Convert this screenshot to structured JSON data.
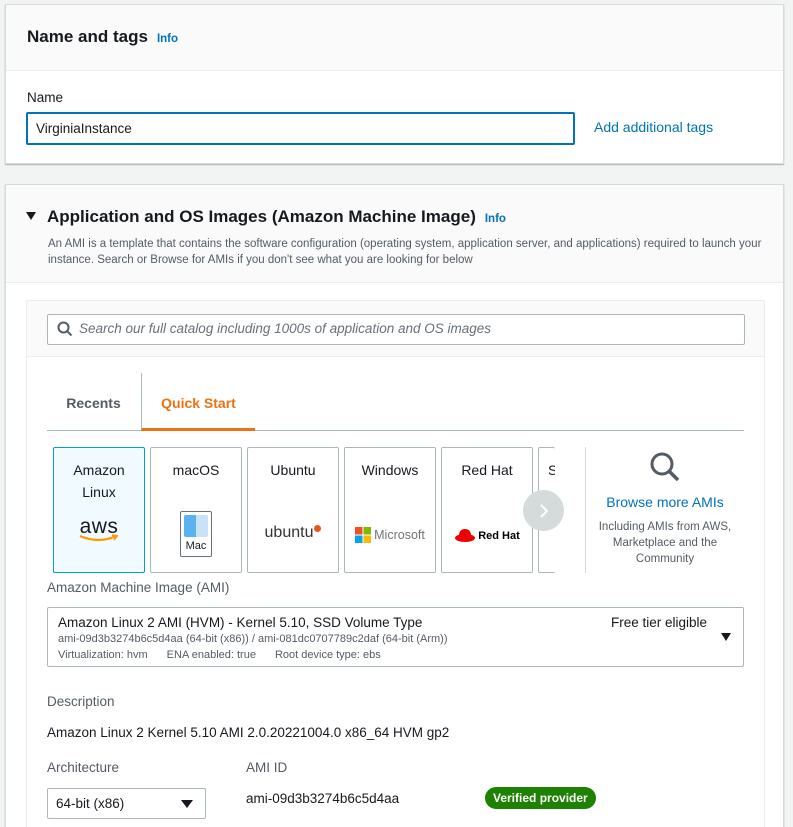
{
  "name_panel": {
    "title": "Name and tags",
    "info": "Info",
    "name_label": "Name",
    "name_value": "VirginiaInstance",
    "add_tags": "Add additional tags"
  },
  "ami_panel": {
    "title": "Application and OS Images (Amazon Machine Image)",
    "info": "Info",
    "description": "An AMI is a template that contains the software configuration (operating system, application server, and applications) required to launch your instance. Search or Browse for AMIs if you don't see what you are looking for below",
    "search_placeholder": "Search our full catalog including 1000s of application and OS images",
    "tabs": {
      "recents": "Recents",
      "quick_start": "Quick Start"
    },
    "tiles": [
      {
        "label_line1": "Amazon",
        "label_line2": "Linux",
        "logo_text": "aws",
        "selected": true
      },
      {
        "label_line1": "macOS",
        "logo_text": "Mac"
      },
      {
        "label_line1": "Ubuntu",
        "logo_text": "ubuntu"
      },
      {
        "label_line1": "Windows",
        "logo_text": "Microsoft"
      },
      {
        "label_line1": "Red Hat",
        "logo_text": "Red Hat"
      },
      {
        "label_line1": "S"
      }
    ],
    "browse": {
      "link": "Browse more AMIs",
      "subtitle": "Including AMIs from AWS, Marketplace and the Community"
    },
    "ami_label": "Amazon Machine Image (AMI)",
    "ami_selected": {
      "name": "Amazon Linux 2 AMI (HVM) - Kernel 5.10, SSD Volume Type",
      "ids": "ami-09d3b3274b6c5d4aa (64-bit (x86)) / ami-081dc0707789c2daf (64-bit (Arm))",
      "virtualization": "Virtualization: hvm",
      "ena": "ENA enabled: true",
      "root_device": "Root device type: ebs",
      "free_tier": "Free tier eligible"
    },
    "desc_label": "Description",
    "desc_value": "Amazon Linux 2 Kernel 5.10 AMI 2.0.20221004.0 x86_64 HVM gp2",
    "arch_label": "Architecture",
    "arch_value": "64-bit (x86)",
    "amiid_label": "AMI ID",
    "amiid_value": "ami-09d3b3274b6c5d4aa",
    "verified": "Verified provider"
  },
  "colors": {
    "link": "#0073bb",
    "accent": "#ec7211",
    "verified": "#1d8102"
  }
}
